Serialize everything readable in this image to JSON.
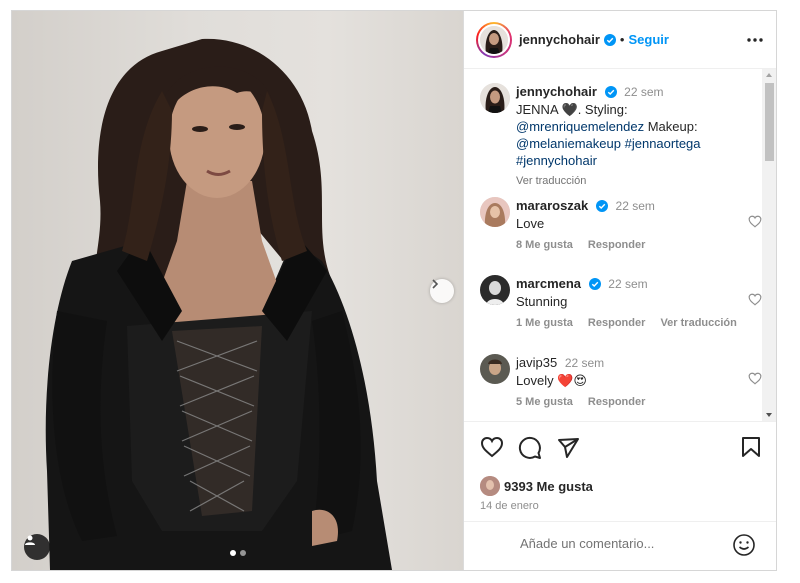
{
  "post": {
    "username": "jennychohair",
    "follow_label": "Seguir",
    "separator": "•"
  },
  "caption": {
    "username": "jennychohair",
    "time": "22 sem",
    "text_parts": [
      "JENNA 🖤. Styling:",
      "@mrenriquemelendez",
      "Makeup:",
      "@melaniemakeup",
      "#jennaortega",
      "#jennychohair"
    ],
    "see_translation": "Ver traducción"
  },
  "comments": [
    {
      "username": "mararoszak",
      "verified": true,
      "time": "22 sem",
      "text": "Love",
      "likes": "8 Me gusta",
      "reply": "Responder",
      "translate": ""
    },
    {
      "username": "marcmena",
      "verified": true,
      "time": "22 sem",
      "text": "Stunning",
      "likes": "1 Me gusta",
      "reply": "Responder",
      "translate": "Ver traducción"
    },
    {
      "username": "javip35",
      "verified": false,
      "time": "22 sem",
      "text": "Lovely ❤️😍",
      "likes": "5 Me gusta",
      "reply": "Responder",
      "translate": ""
    }
  ],
  "stats": {
    "likes_label": "9393 Me gusta",
    "date": "14 de enero"
  },
  "comment_box": {
    "placeholder": "Añade un comentario..."
  },
  "carousel": {
    "current": 1,
    "total": 2
  },
  "colors": {
    "accent": "#0095f6",
    "verified": "#0095f6",
    "link": "#00376b",
    "muted": "#8e8e8e"
  },
  "icons": [
    "verified-badge-icon",
    "more-options-icon",
    "heart-icon",
    "comment-icon",
    "share-icon",
    "bookmark-icon",
    "emoji-icon",
    "chevron-right-icon",
    "user-tag-icon"
  ]
}
